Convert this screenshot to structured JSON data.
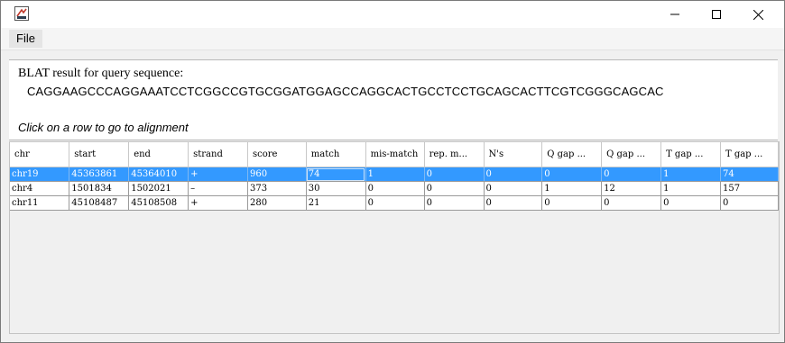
{
  "window": {
    "title": "",
    "controls": [
      "minimize",
      "maximize",
      "close"
    ]
  },
  "menubar": {
    "items": [
      {
        "label": "File"
      }
    ]
  },
  "info": {
    "title": "BLAT result for query sequence:",
    "sequence": "CAGGAAGCCCAGGAAATCCTCGGCCGTGCGGATGGAGCCAGGCACTGCCTCCTGCAGCACTTCGTCGGGCAGCAC",
    "hint": "Click on a row to go to alignment"
  },
  "table": {
    "columns": [
      "chr",
      "start",
      "end",
      "strand",
      "score",
      "match",
      "mis-match",
      "rep. m...",
      "N's",
      "Q gap ...",
      "Q gap ...",
      "T gap ...",
      "T gap ..."
    ],
    "rows": [
      [
        "chr19",
        "45363861",
        "45364010",
        "+",
        "960",
        "74",
        "1",
        "0",
        "0",
        "0",
        "0",
        "1",
        "74"
      ],
      [
        "chr4",
        "1501834",
        "1502021",
        "–",
        "373",
        "30",
        "0",
        "0",
        "0",
        "1",
        "12",
        "1",
        "157"
      ],
      [
        "chr11",
        "45108487",
        "45108508",
        "+",
        "280",
        "21",
        "0",
        "0",
        "0",
        "0",
        "0",
        "0",
        "0"
      ]
    ],
    "selected_row": 0
  },
  "colors": {
    "selection": "#3399ff",
    "panel": "#ffffff",
    "background": "#f0f0f0"
  }
}
